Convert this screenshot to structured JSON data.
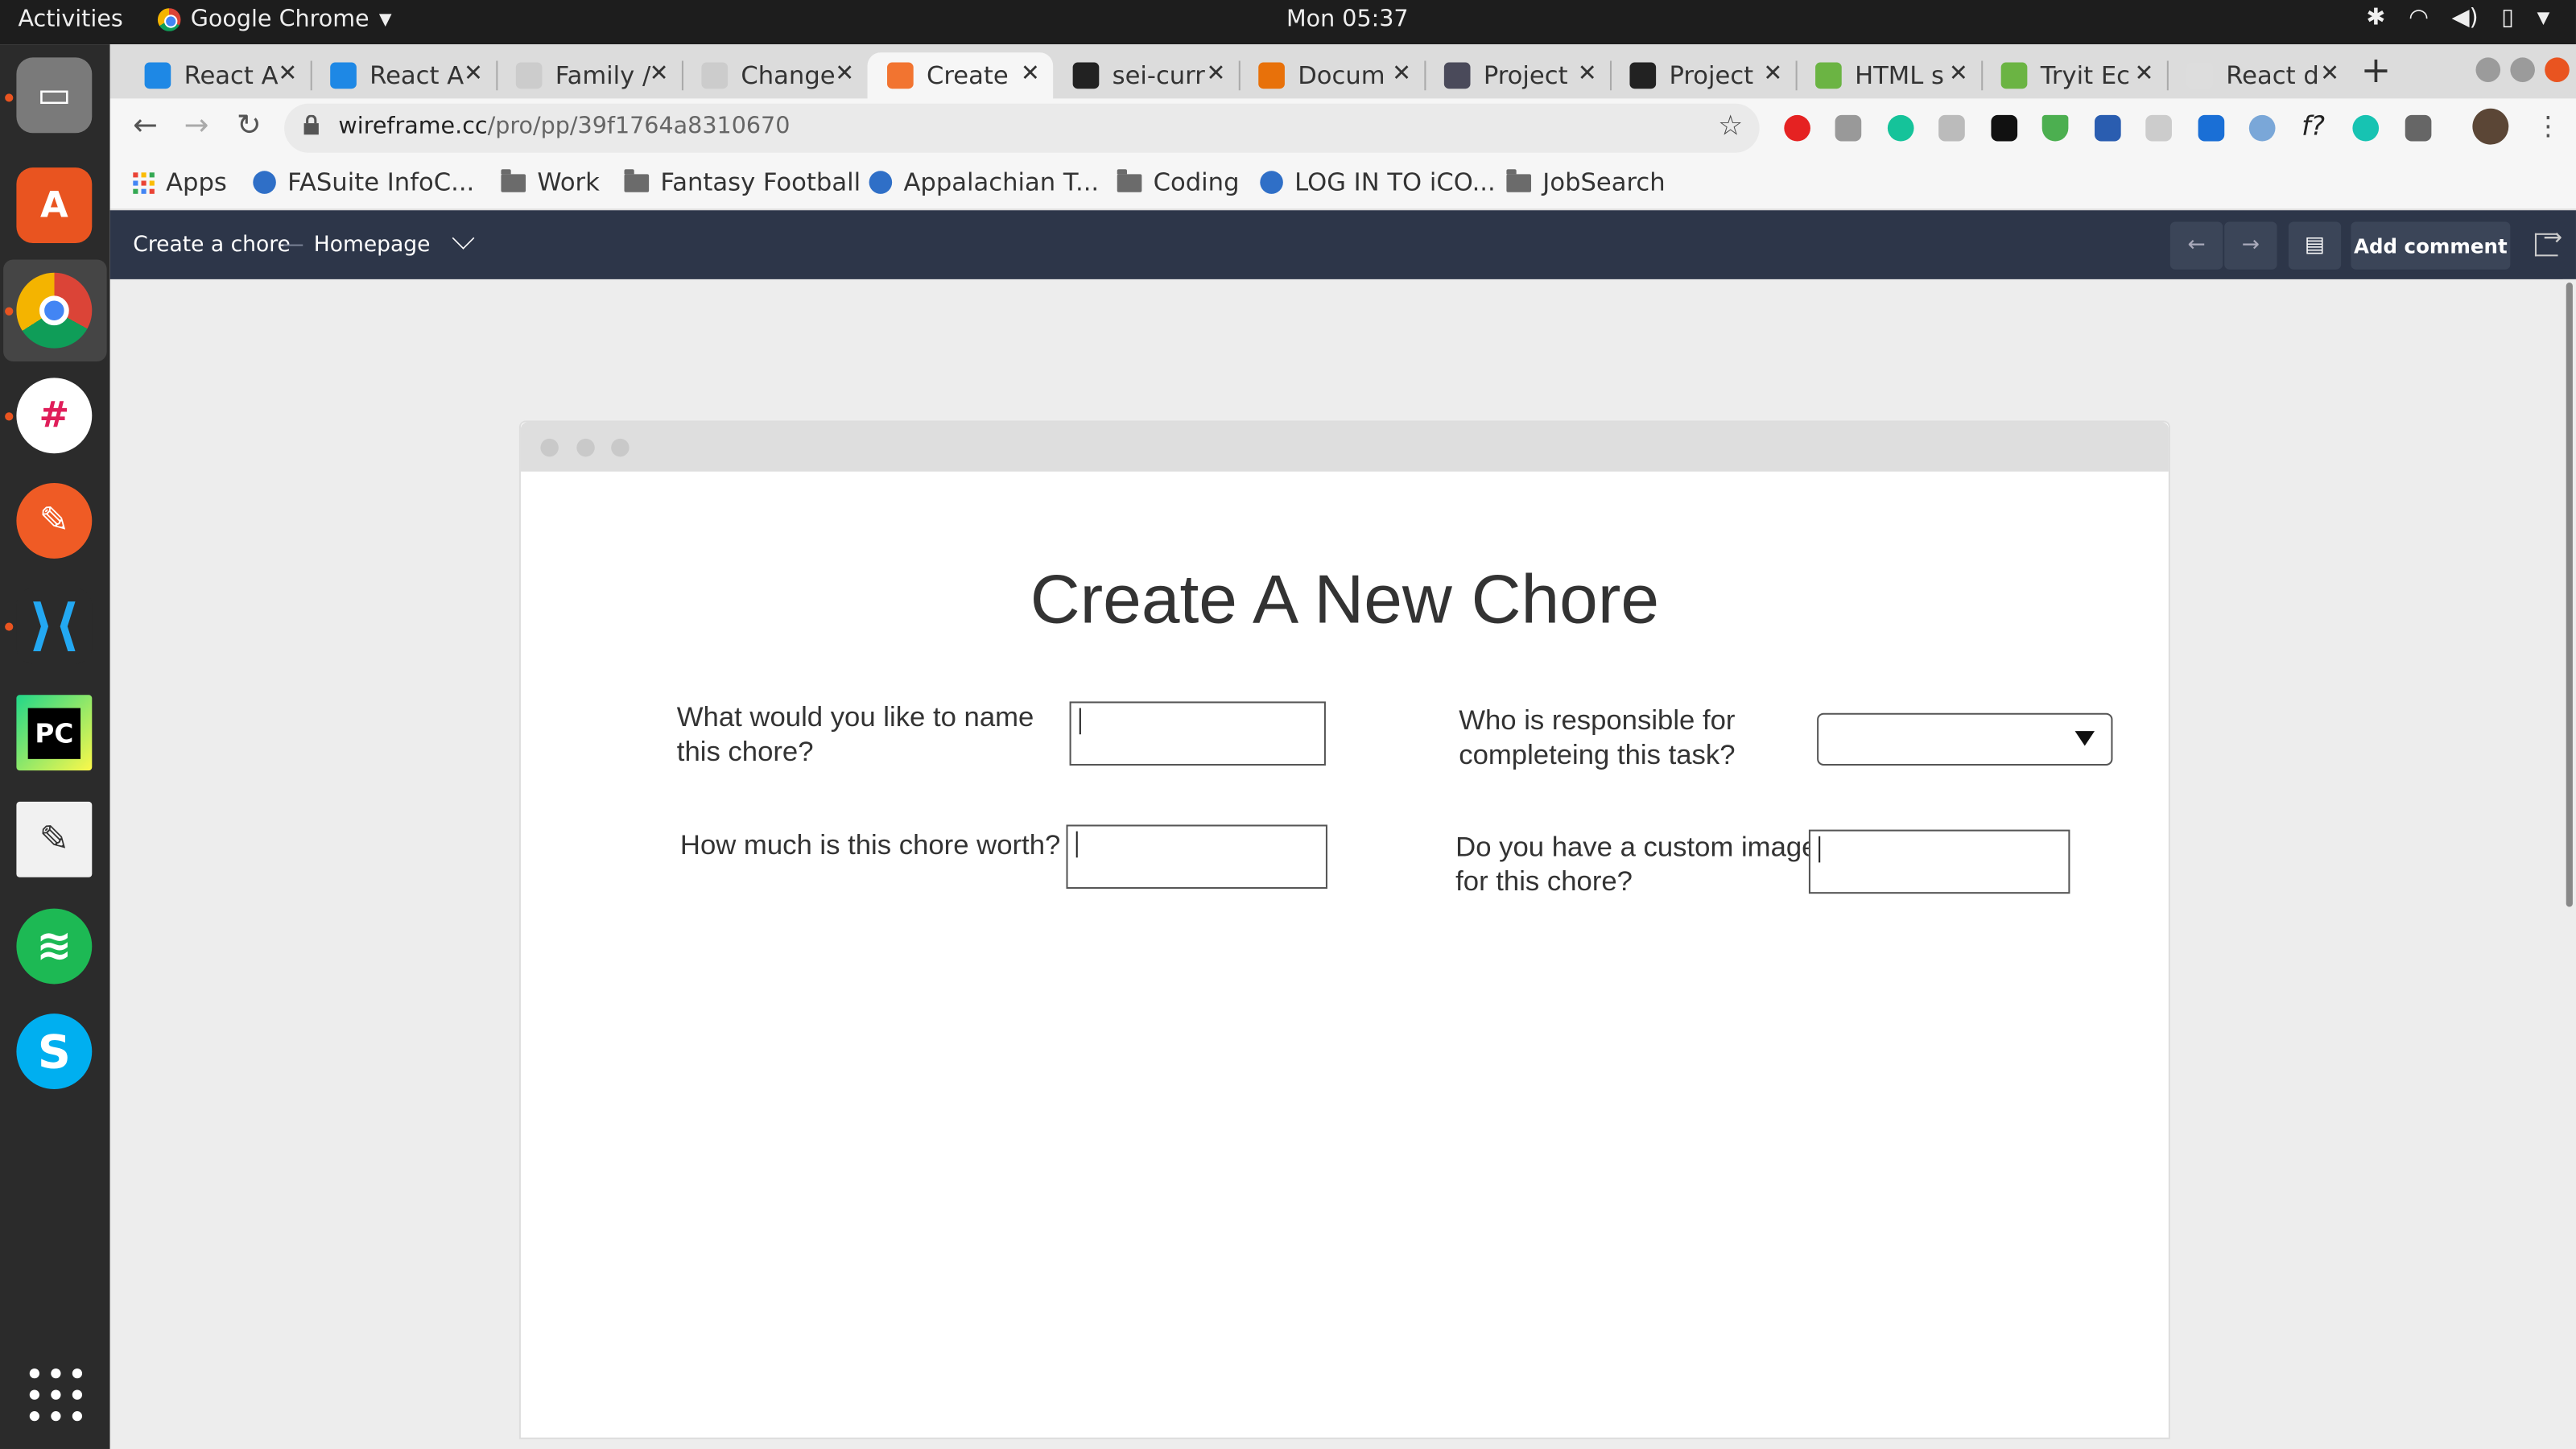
{
  "system": {
    "activities": "Activities",
    "app_name": "Google Chrome",
    "clock": "Mon 05:37"
  },
  "browser": {
    "tabs": [
      {
        "label": "React A",
        "color": "#1e88e5"
      },
      {
        "label": "React A",
        "color": "#1e88e5"
      },
      {
        "label": "Family /",
        "color": "#cccccc"
      },
      {
        "label": "Change",
        "color": "#cccccc"
      },
      {
        "label": "Create",
        "color": "#f27430"
      },
      {
        "label": "sei-curr",
        "color": "#222222"
      },
      {
        "label": "Docum",
        "color": "#e8710a"
      },
      {
        "label": "Project",
        "color": "#4a4a5a"
      },
      {
        "label": "Project",
        "color": "#222222"
      },
      {
        "label": "HTML s",
        "color": "#6bb443"
      },
      {
        "label": "Tryit Ec",
        "color": "#6bb443"
      },
      {
        "label": "React d",
        "color": "#dddddd"
      }
    ],
    "url_host": "wireframe.cc",
    "url_path": "/pro/pp/39f1764a8310670",
    "bookmarks": [
      {
        "label": "Apps",
        "kind": "apps"
      },
      {
        "label": "FASuite InfoC...",
        "kind": "site"
      },
      {
        "label": "Work",
        "kind": "folder"
      },
      {
        "label": "Fantasy Football",
        "kind": "folder"
      },
      {
        "label": "Appalachian T...",
        "kind": "site"
      },
      {
        "label": "Coding",
        "kind": "folder"
      },
      {
        "label": "LOG IN TO iCO...",
        "kind": "site"
      },
      {
        "label": "JobSearch",
        "kind": "folder"
      }
    ]
  },
  "wireframe_app": {
    "page_name": "Create a chore",
    "separator": "—",
    "current_page": "Homepage",
    "add_comment": "Add comment"
  },
  "chore_form": {
    "title": "Create A New Chore",
    "name_label": "What would you like to name this chore?",
    "responsible_label": "Who is responsible for completeing this task?",
    "worth_label": "How much is this chore worth?",
    "image_label": "Do you have a custom image for this chore?"
  },
  "colors": {
    "app_header": "#2d3649",
    "ubuntu_accent": "#e95420"
  }
}
